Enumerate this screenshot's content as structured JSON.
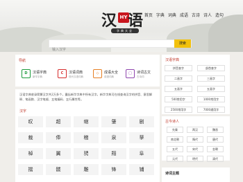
{
  "logo": {
    "char1": "汉",
    "char2": "语",
    "seal": "HY",
    "subtitle": "字典大全"
  },
  "topnav": [
    "首页",
    "字典",
    "词典",
    "成语",
    "古诗",
    "诗人",
    "造句"
  ],
  "search": {
    "placeholder": "输入汉字",
    "button": "搜索"
  },
  "nav": {
    "title": "导航",
    "items": [
      {
        "icon": "D",
        "title": "汉语字典",
        "desc": "新华字典",
        "color": "#1a9a3a"
      },
      {
        "icon": "C",
        "title": "汉语词典",
        "desc": "现代汉语词典",
        "color": "#d62b2b"
      },
      {
        "icon": "◇",
        "title": "成语大全",
        "desc": "成语词典",
        "color": "#e67e22"
      },
      {
        "icon": "□",
        "title": "诗词古文",
        "desc": "古诗词",
        "color": "#8e44ad"
      }
    ]
  },
  "intro": "汉语字典收录简繁汉字共2万多个，囊括新华字典中所有汉字。新华字典可在线查询汉字的拼音、意思解释、笔画数、汉字笔顺、五笔编码、五行属性等。",
  "hanzi": {
    "title": "汉字",
    "chars": [
      "叹",
      "超",
      "缩",
      "肇",
      "剧",
      "裁",
      "俸",
      "稽",
      "泉",
      "孳",
      "棹",
      "翼",
      "骋",
      "翔",
      "阜",
      "揣",
      "髅",
      "雕",
      "锋",
      "铺"
    ]
  },
  "sidebar_dict": {
    "title": "汉语字典",
    "items": [
      "拼音查字",
      "部首查字",
      "二画字",
      "三画字",
      "五画字",
      "五画字",
      "500常用字",
      "1000常用字",
      "2500常用字",
      "7000通用字"
    ]
  },
  "sidebar_poets": {
    "title": "古今诗人",
    "items": [
      "先秦",
      "两汉",
      "魏晋",
      "南北朝",
      "隋代",
      "唐代",
      "五代",
      "宋代",
      "金朝",
      "元代",
      "明代",
      "清代"
    ]
  },
  "sidebar_topics": {
    "title": "诗词主题"
  },
  "colors": {
    "accent": "#c0392b",
    "button": "#f2c10c"
  }
}
